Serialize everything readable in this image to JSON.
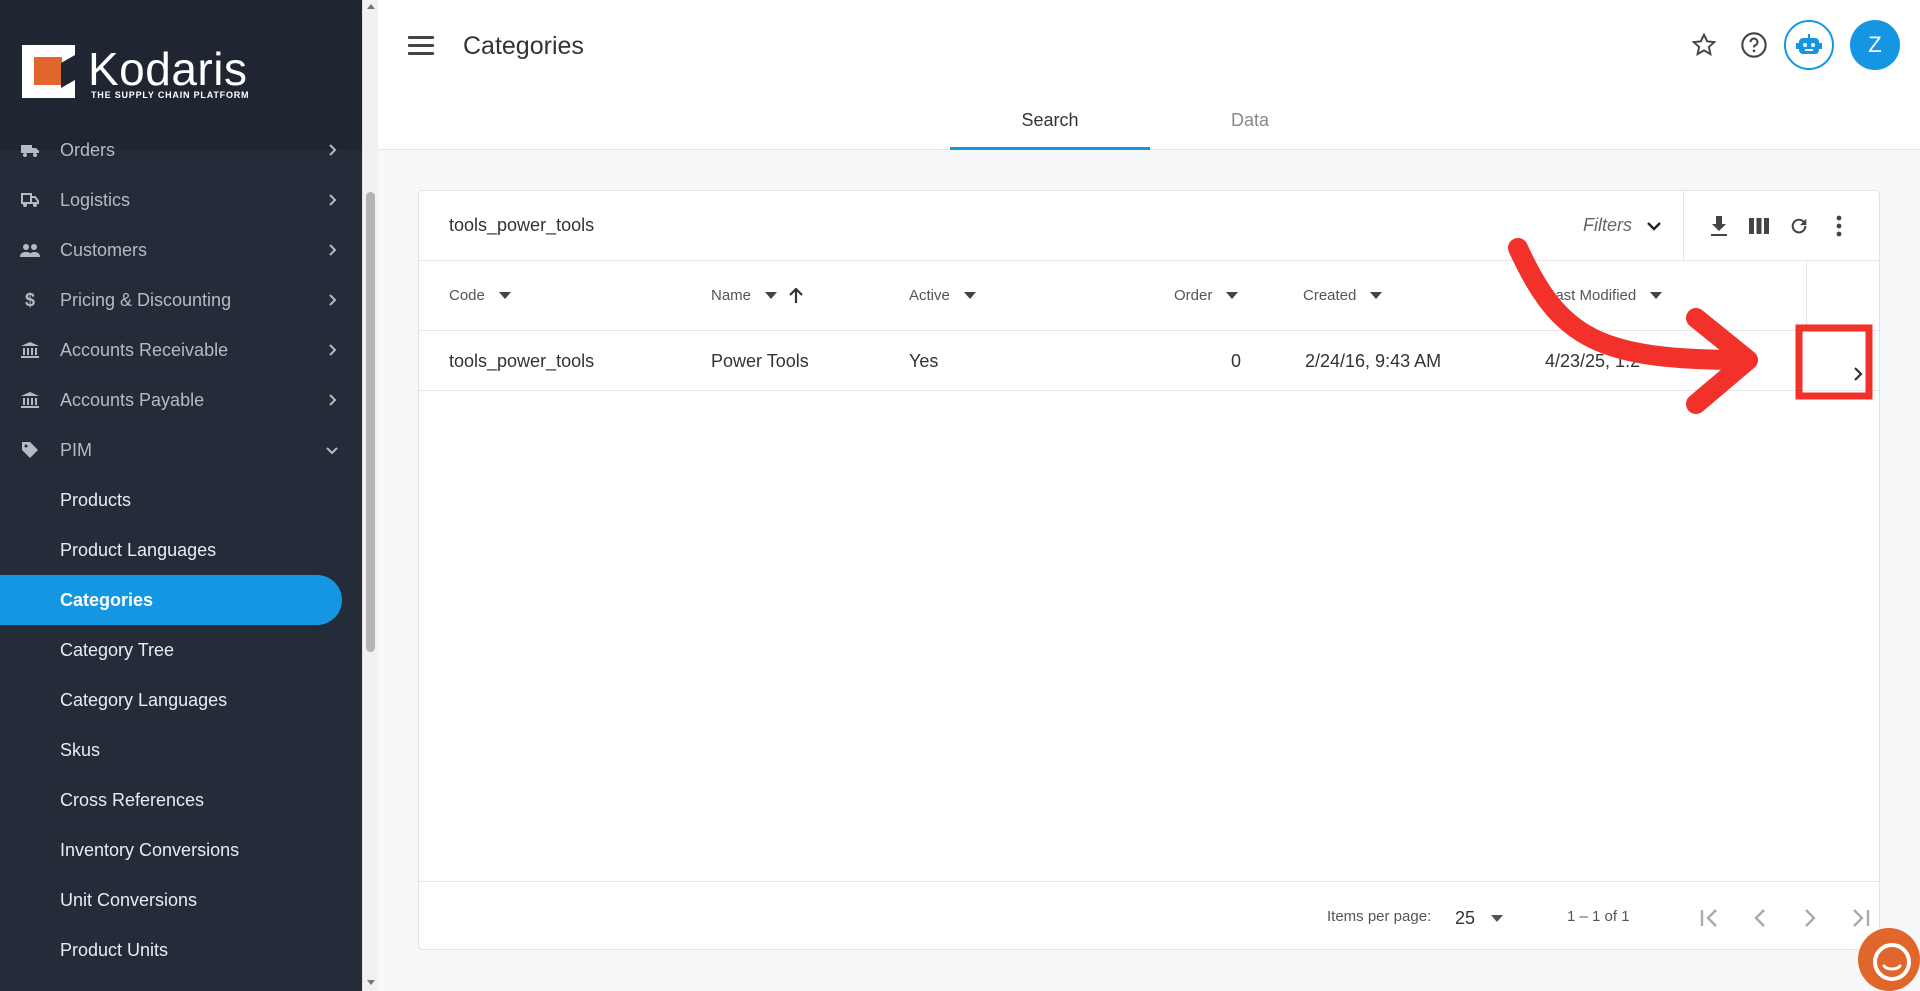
{
  "brand": {
    "name": "Kodaris",
    "tagline": "THE SUPPLY CHAIN PLATFORM"
  },
  "sidebar": {
    "items": [
      {
        "label": "Orders",
        "icon": "truck-icon"
      },
      {
        "label": "Logistics",
        "icon": "shipping-icon"
      },
      {
        "label": "Customers",
        "icon": "people-icon"
      },
      {
        "label": "Pricing & Discounting",
        "icon": "dollar-icon"
      },
      {
        "label": "Accounts Receivable",
        "icon": "bank-icon"
      },
      {
        "label": "Accounts Payable",
        "icon": "bank-icon"
      },
      {
        "label": "PIM",
        "icon": "tag-icon"
      }
    ],
    "pim_sub": [
      "Products",
      "Product Languages",
      "Categories",
      "Category Tree",
      "Category Languages",
      "Skus",
      "Cross References",
      "Inventory Conversions",
      "Unit Conversions",
      "Product Units"
    ],
    "active_item": "Categories"
  },
  "header": {
    "title": "Categories",
    "avatar_initial": "Z",
    "tabs": [
      {
        "label": "Search",
        "active": true
      },
      {
        "label": "Data",
        "active": false
      }
    ]
  },
  "table": {
    "search_value": "tools_power_tools",
    "filters_label": "Filters",
    "columns": [
      "Code",
      "Name",
      "Active",
      "Order",
      "Created",
      "Last Modified"
    ],
    "sort": {
      "column": "Name",
      "direction": "ascending"
    },
    "rows": [
      {
        "code": "tools_power_tools",
        "name": "Power Tools",
        "active": "Yes",
        "order": "0",
        "created": "2/24/16, 9:43 AM",
        "last_modified": "4/23/25, 1:2"
      }
    ],
    "footer": {
      "items_per_page_label": "Items per page:",
      "items_per_page": "25",
      "range": "1 – 1 of 1"
    }
  },
  "colors": {
    "accent": "#1596e3",
    "sidebar": "#242c39",
    "annotation": "#f2322a",
    "brand_orange": "#e0662c"
  }
}
